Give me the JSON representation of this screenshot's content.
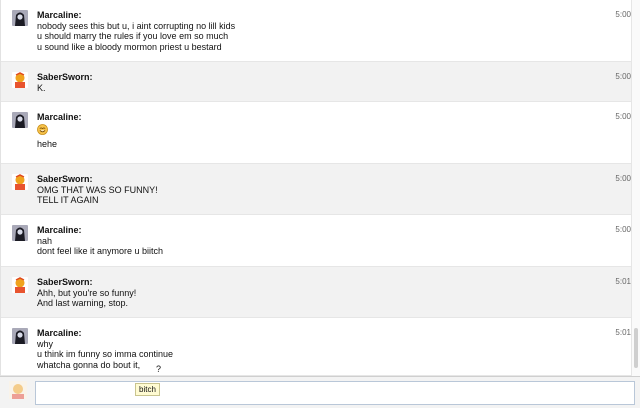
{
  "messages": [
    {
      "sender": "Marcaline:",
      "avatar": "marcaline-avatar",
      "time": "5:00",
      "alt": false,
      "height": 62,
      "lines": [
        "nobody sees this but u, i aint corrupting no lill kids",
        "u should marry the rules if you love em so much",
        "u sound like a bloody mormon priest u bestard"
      ]
    },
    {
      "sender": "SaberSworn:",
      "avatar": "sabersworn-avatar",
      "time": "5:00",
      "alt": true,
      "height": 40,
      "lines": [
        "K."
      ]
    },
    {
      "sender": "Marcaline:",
      "avatar": "marcaline-avatar",
      "time": "5:00",
      "alt": false,
      "height": 62,
      "lines": [
        "EMOJI",
        "hehe"
      ]
    },
    {
      "sender": "SaberSworn:",
      "avatar": "sabersworn-avatar",
      "time": "5:00",
      "alt": true,
      "height": 51,
      "lines": [
        "OMG THAT WAS SO FUNNY!",
        "TELL IT AGAIN"
      ]
    },
    {
      "sender": "Marcaline:",
      "avatar": "marcaline-avatar",
      "time": "5:00",
      "alt": false,
      "height": 52,
      "lines": [
        "nah",
        "dont feel like it anymore u biitch"
      ]
    },
    {
      "sender": "SaberSworn:",
      "avatar": "sabersworn-avatar",
      "time": "5:01",
      "alt": true,
      "height": 51,
      "lines": [
        "Ahh, but you're so funny!",
        "And last warning, stop."
      ]
    },
    {
      "sender": "Marcaline:",
      "avatar": "marcaline-avatar",
      "time": "5:01",
      "alt": false,
      "height": 58,
      "lines": [
        "why",
        "u think im funny so imma continue",
        "whatcha gonna do bout it,"
      ]
    }
  ],
  "input": {
    "value": "",
    "placeholder": ""
  },
  "tooltip": "bitch",
  "question_mark": "?",
  "colors": {
    "alt_row": "#f2f2f2",
    "input_border": "#b9c7d8",
    "tooltip_bg": "#fffbd2"
  }
}
